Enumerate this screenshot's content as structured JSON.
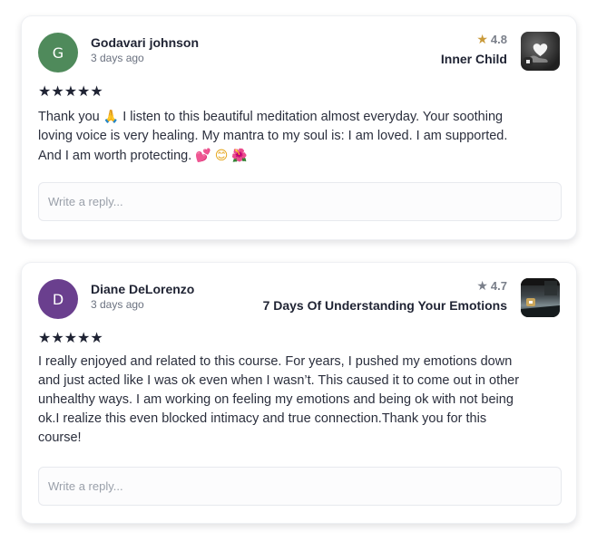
{
  "reviews": [
    {
      "avatar_initial": "G",
      "avatar_color": "#4f8a5b",
      "author": "Godavari johnson",
      "time": "3 days ago",
      "rating": "4.8",
      "course": "Inner Child",
      "stars": "★★★★★",
      "text": "Thank you",
      "text_rest": "I listen to this beautiful meditation almost everyday. Your soothing loving voice is very healing. My mantra to my soul is: I am loved. I am supported. And I am worth protecting.",
      "emoji_1": "🙏",
      "emoji_2": "💕",
      "emoji_3": "😊",
      "emoji_4": "🌺",
      "reply_placeholder": "Write a reply..."
    },
    {
      "avatar_initial": "D",
      "avatar_color": "#6a3f8e",
      "author": "Diane DeLorenzo",
      "time": "3 days ago",
      "rating": "4.7",
      "course": "7 Days Of Understanding Your Emotions",
      "stars": "★★★★★",
      "text": "I really enjoyed and related to this course. For years, I pushed my emotions down and just acted like I was ok even when I wasn’t. This caused it to come out in other unhealthy ways. I am working on feeling my emotions and being ok with not being ok.I realize this even blocked intimacy and true connection.Thank you for this course!",
      "reply_placeholder": "Write a reply..."
    }
  ],
  "colors": {
    "rating_star_1": "#c99a3a",
    "rating_star_2": "#7a7f8a",
    "text_dark": "#1f2333"
  }
}
